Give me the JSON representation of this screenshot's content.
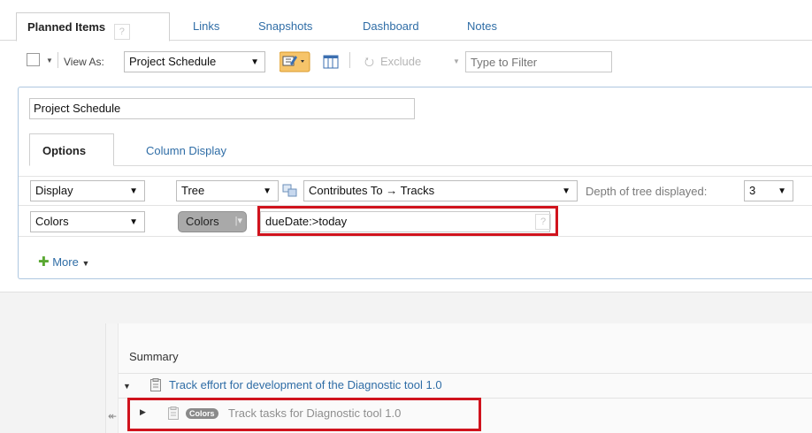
{
  "tabs": {
    "planned_items": "Planned Items",
    "help": "?",
    "links": "Links",
    "snapshots": "Snapshots",
    "dashboard": "Dashboard",
    "notes": "Notes"
  },
  "toolbar": {
    "view_as_label": "View As:",
    "view_as_value": "Project Schedule",
    "exclude_label": "Exclude",
    "filter_placeholder": "Type to Filter"
  },
  "panel": {
    "view_name": "Project Schedule",
    "subtabs": {
      "options": "Options",
      "column_display": "Column Display"
    },
    "row1": {
      "display": "Display",
      "tree": "Tree",
      "contributes": "Contributes To → Tracks",
      "depth_label": "Depth of tree displayed:",
      "depth_value": "3"
    },
    "row2": {
      "colors_select": "Colors",
      "colors_button": "Colors",
      "query": "dueDate:>today",
      "query_help": "?"
    },
    "more": "More"
  },
  "grid": {
    "summary_header": "Summary",
    "rows": [
      {
        "title": "Track effort for development of the Diagnostic tool 1.0"
      },
      {
        "tag": "Colors",
        "title": "Track tasks for Diagnostic tool 1.0"
      }
    ]
  },
  "colors": {
    "link": "#2f6da6",
    "highlight": "#d0131d",
    "panel_border": "#aec7e0"
  }
}
